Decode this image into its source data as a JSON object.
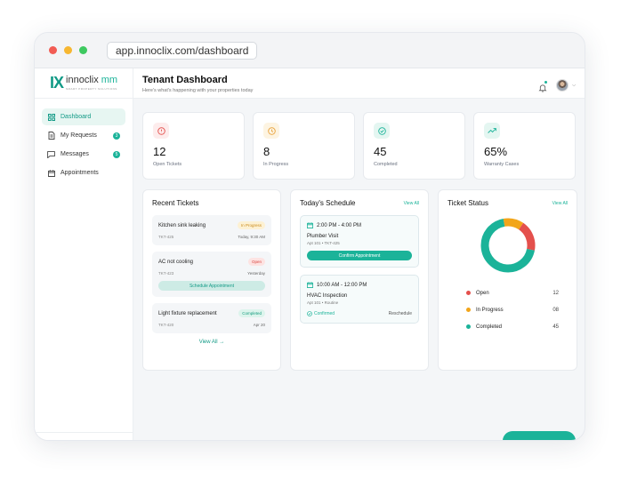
{
  "browser": {
    "url": "app.innoclix.com/dashboard"
  },
  "brand": {
    "mark": "IX",
    "name_a": "innoclix",
    "name_b": " mm",
    "tagline": "SMART PROPERTY SOLUTIONS"
  },
  "sidebar": {
    "items": [
      {
        "label": "Dashboard",
        "icon": "grid-icon",
        "active": true,
        "badge": ""
      },
      {
        "label": "My Requests",
        "icon": "document-icon",
        "active": false,
        "badge": "3"
      },
      {
        "label": "Messages",
        "icon": "chat-icon",
        "active": false,
        "badge": "5"
      },
      {
        "label": "Appointments",
        "icon": "calendar-icon",
        "active": false,
        "badge": ""
      }
    ]
  },
  "header": {
    "title": "Tenant Dashboard",
    "subtitle": "Here's what's happening with your properties today"
  },
  "stats": [
    {
      "value": "12",
      "label": "Open Tickets",
      "icon": "alert-circle-icon",
      "color": "#e4504c",
      "bg": "#fdecec"
    },
    {
      "value": "8",
      "label": "In Progress",
      "icon": "clock-icon",
      "color": "#e9a23b",
      "bg": "#fdf4e2"
    },
    {
      "value": "45",
      "label": "Completed",
      "icon": "check-circle-icon",
      "color": "#1bb399",
      "bg": "#e4f6f1"
    },
    {
      "value": "65%",
      "label": "Warranty Cases",
      "icon": "trending-up-icon",
      "color": "#1bb399",
      "bg": "#e4f6f1"
    }
  ],
  "recent": {
    "title": "Recent Tickets",
    "tickets": [
      {
        "title": "Kitchen sink leaking",
        "status": "In Progress",
        "id": "TKT-425",
        "date": "Today, 9:30 AM",
        "status_color": "#c98a1a",
        "status_bg": "#fdf1d3"
      },
      {
        "title": "AC not cooling",
        "status": "Open",
        "id": "TKT-423",
        "date": "Yesterday",
        "status_color": "#d9443f",
        "status_bg": "#fde3e2",
        "action": "Schedule Appointment"
      },
      {
        "title": "Light fixture replacement",
        "status": "Completed",
        "id": "TKT-420",
        "date": "Apr 20",
        "status_color": "#139a7d",
        "status_bg": "#dcf4ec"
      }
    ],
    "view_all": "View All →"
  },
  "schedule": {
    "title": "Today's Schedule",
    "view_all": "View All",
    "appointments": [
      {
        "time": "2:00 PM - 4:00 PM",
        "name": "Plumber Visit",
        "meta": "Apt 101 • TKT-425",
        "action": "Confirm Appointment"
      },
      {
        "time": "10:00 AM - 12:00 PM",
        "name": "HVAC Inspection",
        "meta": "Apt 101 • Routine",
        "confirmed": "Confirmed",
        "reschedule": "Reschedule"
      }
    ]
  },
  "status": {
    "title": "Ticket Status",
    "view_all": "View All",
    "legend": [
      {
        "label": "Open",
        "value": "12",
        "color": "#e4504c"
      },
      {
        "label": "In Progress",
        "value": "08",
        "color": "#f2a51a"
      },
      {
        "label": "Completed",
        "value": "45",
        "color": "#1bb399"
      }
    ]
  }
}
